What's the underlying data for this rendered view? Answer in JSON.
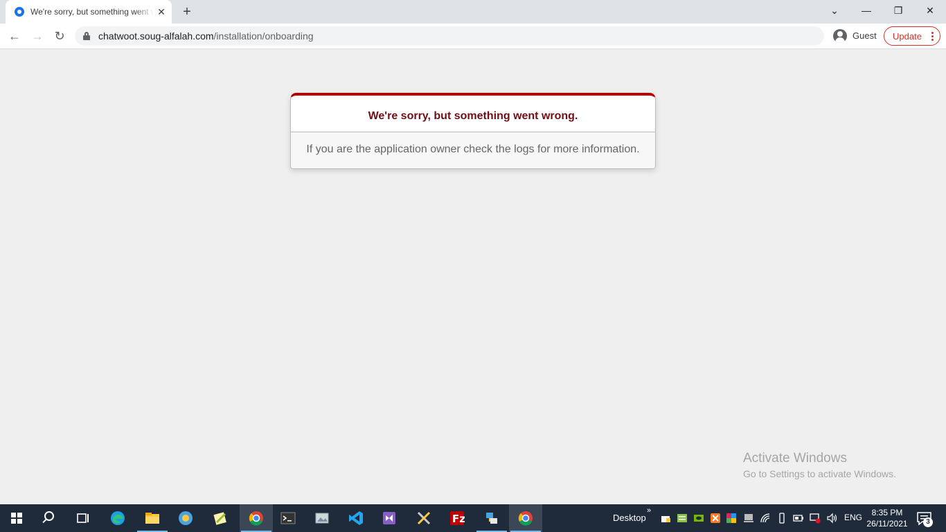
{
  "browser": {
    "tab": {
      "title": "We're sorry, but something went wrong",
      "close_glyph": "✕"
    },
    "new_tab_glyph": "+",
    "window_controls": {
      "tabsearch": "⌄",
      "minimize": "—",
      "restore": "❐",
      "close": "✕"
    },
    "nav": {
      "back": "←",
      "forward": "→",
      "reload": "↻"
    },
    "address": {
      "host": "chatwoot.soug-alfalah.com",
      "path": "/installation/onboarding"
    },
    "profile_label": "Guest",
    "update_label": "Update"
  },
  "page": {
    "error_title": "We're sorry, but something went wrong.",
    "error_message": "If you are the application owner check the logs for more information."
  },
  "watermark": {
    "title": "Activate Windows",
    "subtitle": "Go to Settings to activate Windows."
  },
  "taskbar": {
    "apps": [
      "start-icon",
      "search-icon",
      "task-view-icon",
      "edge-icon",
      "file-explorer-icon",
      "browser-globe-icon",
      "notepad-plus-icon",
      "chrome-icon",
      "terminal-icon",
      "photo-viewer-icon",
      "vscode-icon",
      "visual-studio-icon",
      "tools-icon",
      "filezilla-icon",
      "network-app-icon",
      "chrome-icon"
    ],
    "desktop_label": "Desktop",
    "tray_chevron": "»",
    "language": "ENG",
    "time": "8:35 PM",
    "date": "26/11/2021",
    "notification_count": "3"
  },
  "colors": {
    "accent_error": "#b00100",
    "error_title": "#730e15",
    "update_red": "#d93025",
    "taskbar": "#1f2b3a"
  }
}
